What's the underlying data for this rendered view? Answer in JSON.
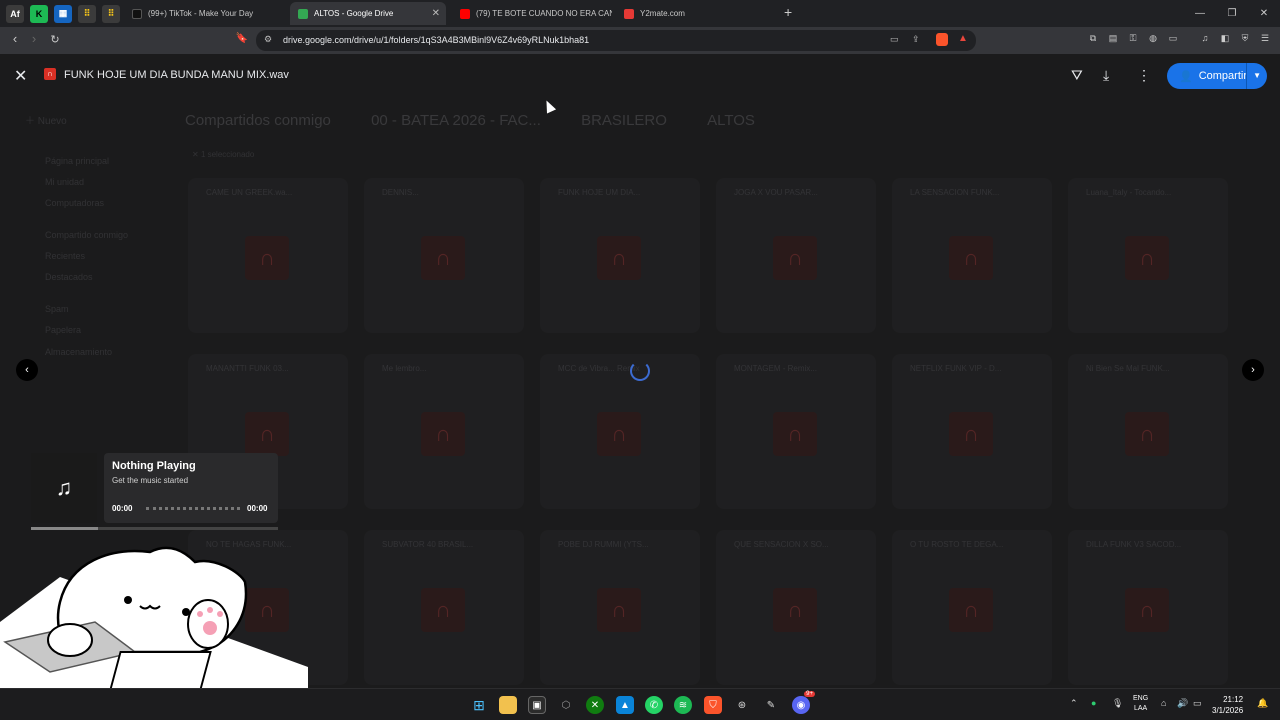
{
  "browser": {
    "tabs": [
      {
        "label": "(99+) TikTok - Make Your Day",
        "favicon_color": "#111111",
        "active": false
      },
      {
        "label": "ALTOS - Google Drive",
        "favicon_color": "#34a853",
        "active": true
      },
      {
        "label": "(79) TE BOTE CUANDO NO ERA CAN",
        "favicon_color": "#ff0000",
        "active": false
      },
      {
        "label": "Y2mate.com",
        "favicon_color": "#e53935",
        "active": false
      }
    ],
    "new_tab": "+",
    "url": "drive.google.com/drive/u/1/folders/1qS3A4B3MBinl9V6Z4v69yRLNuk1bha81"
  },
  "preview": {
    "close_label": "✕",
    "file_name": "FUNK HOJE UM DIA BUNDA MANU MIX.wav",
    "share_label": "Compartir",
    "accent": "#1a73e8"
  },
  "drive_bg": {
    "breadcrumb": [
      "Compartidos conmigo",
      "00 - BATEA 2026 - FAC...",
      "BRASILERO",
      "ALTOS"
    ],
    "selection": "1 seleccionado",
    "sidebar": [
      "Nuevo",
      "Página principal",
      "Mi unidad",
      "Computadoras",
      "Compartido conmigo",
      "Recientes",
      "Destacados",
      "Spam",
      "Papelera",
      "Almacenamiento"
    ],
    "files": [
      "CAME UN GREEK.wa...",
      "DENNIS...",
      "FUNK HOJE UM DIA...",
      "JOGA X VOU PASAR...",
      "LA SENSACION FUNK...",
      "Luana_Italy - Tocando...",
      "MANANTTI FUNK 03...",
      "Me lembro...",
      "MCC de Vibra... Remix",
      "MONTAGEM - Remix...",
      "NETFLIX FUNK VIP - D...",
      "Ni Bien Se Mal FUNK...",
      "NO TE HAGAS FUNK...",
      "SUBVATOR 40 BRASIL...",
      "POBE DJ RUMMI (YTS...",
      "QUE SENSACION X SO...",
      "O TU ROSTO TE DEGA...",
      "DILLA FUNK V3 SACOD..."
    ]
  },
  "music_widget": {
    "title": "Nothing Playing",
    "subtitle": "Get the music started",
    "time_start": "00:00",
    "time_end": "00:00",
    "progress_fraction": 0.27
  },
  "taskbar": {
    "lang_top": "ENG",
    "lang_bottom": "LAA",
    "time": "21:12",
    "date": "3/1/2026",
    "badge": "9+"
  }
}
